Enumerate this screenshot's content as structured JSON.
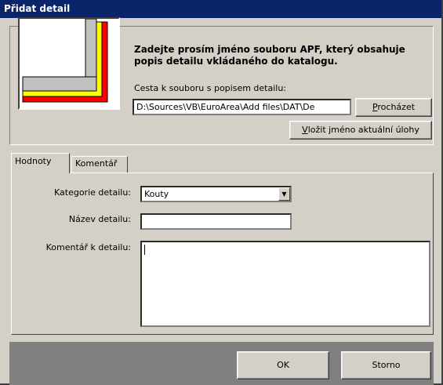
{
  "window": {
    "title": "Přidat detail"
  },
  "header": {
    "instruction_line1": "Zadejte prosím jméno souboru APF, který obsahuje",
    "instruction_line2": "popis detailu vkládaného do katalogu.",
    "path_label": "Cesta k souboru s popisem detailu:",
    "path_value": "D:\\Sources\\VB\\EuroArea\\Add files\\DAT\\De",
    "browse_prefix": "",
    "browse_access": "P",
    "browse_rest": "rocházet",
    "task_access": "V",
    "task_rest": "ložit jméno aktuální úlohy"
  },
  "tabs": [
    {
      "label": "Hodnoty"
    },
    {
      "label": "Komentář"
    }
  ],
  "form": {
    "category_label": "Kategorie detailu:",
    "category_value": "Kouty",
    "name_label": "Název detailu:",
    "name_value": "",
    "comment_label": "Komentář k detailu:",
    "comment_value": ""
  },
  "buttons": {
    "ok": "OK",
    "cancel": "Storno"
  },
  "colors": {
    "title_bar": "#0a246a",
    "face": "#d4d0c8",
    "preview_red": "#ff0000",
    "preview_yellow": "#ffff00",
    "preview_gray": "#c0c0c0"
  }
}
